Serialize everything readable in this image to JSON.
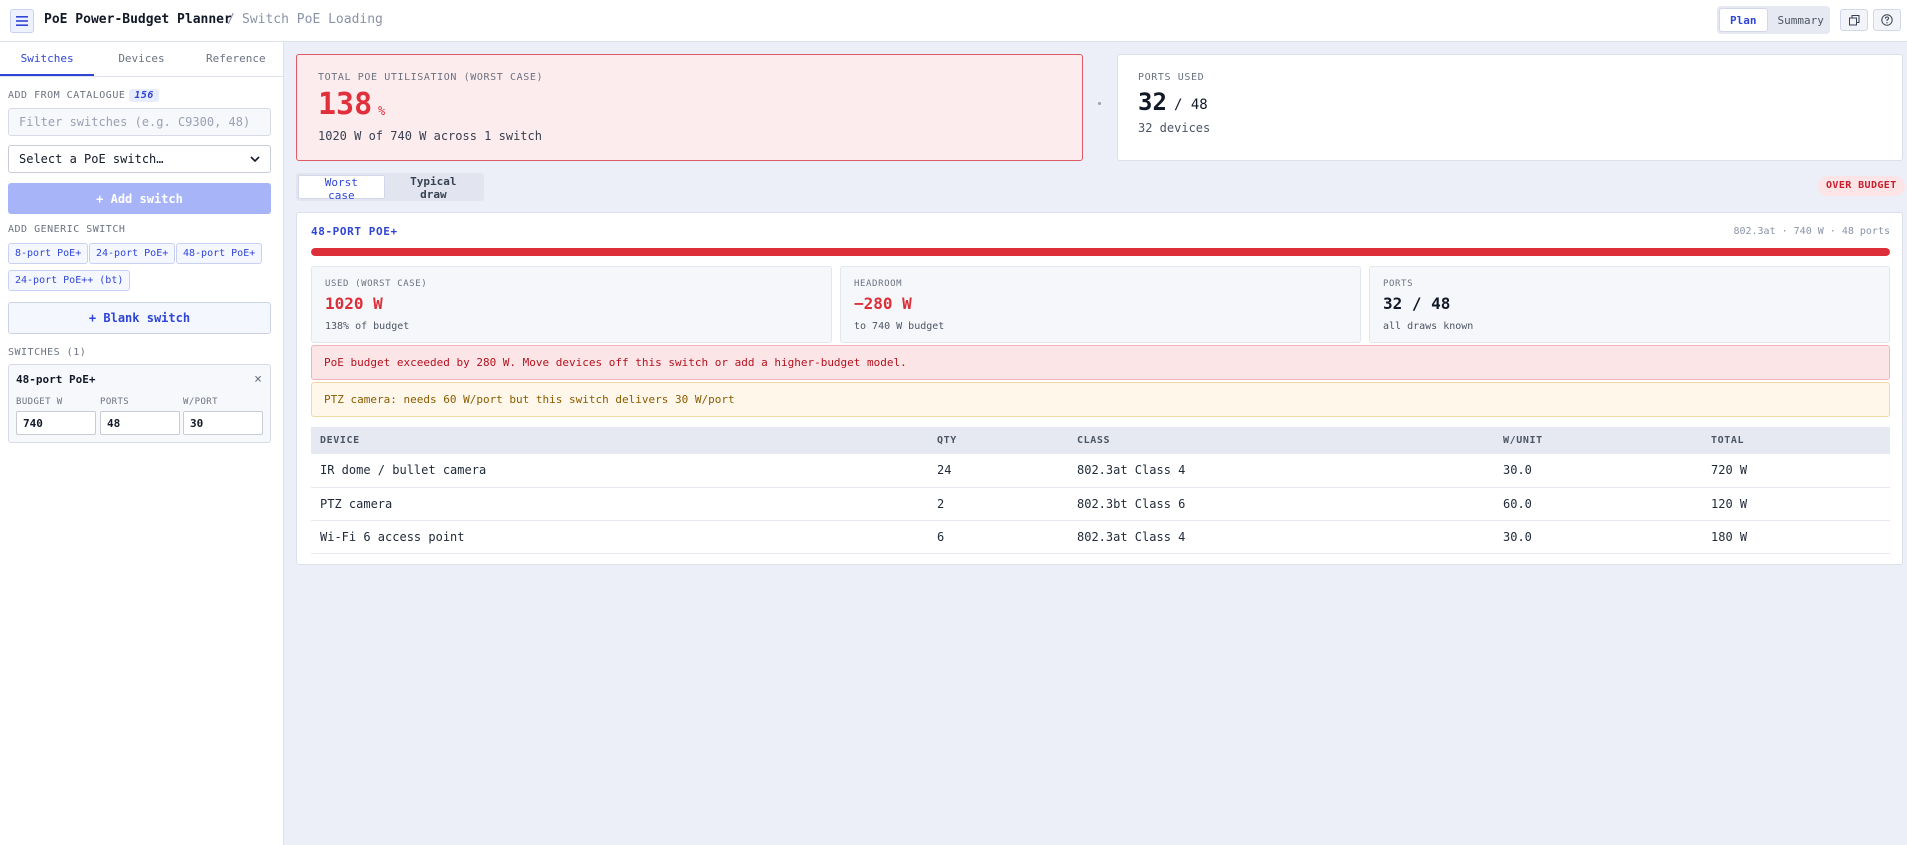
{
  "app": {
    "title": "PoE Power-Budget Planner",
    "separator": "/",
    "page": "Switch PoE Loading"
  },
  "topbar": {
    "modes": [
      "Plan",
      "Summary"
    ],
    "active_mode": "Plan",
    "icons": [
      "copy-icon",
      "help-icon"
    ]
  },
  "sidebar": {
    "tabs": [
      "Switches",
      "Devices",
      "Reference"
    ],
    "active_tab": "Switches",
    "catalogue_label": "ADD FROM CATALOGUE",
    "catalogue_count": "156",
    "filter_placeholder": "Filter switches (e.g. C9300, 48)",
    "select_value": "Select a PoE switch…",
    "add_switch_label": "+ Add switch",
    "generic_label": "ADD GENERIC SWITCH",
    "generic_chips": [
      "8-port PoE+",
      "24-port PoE+",
      "48-port PoE+",
      "24-port PoE++ (bt)"
    ],
    "blank_switch_label": "+ Blank switch",
    "switches_label": "SWITCHES (1)",
    "switch_card": {
      "name": "48-port PoE+",
      "close": "×",
      "fields": [
        {
          "label": "BUDGET W",
          "value": "740"
        },
        {
          "label": "PORTS",
          "value": "48"
        },
        {
          "label": "W/PORT",
          "value": "30"
        }
      ]
    }
  },
  "summary": {
    "util_caption": "TOTAL POE UTILISATION (WORST CASE)",
    "util_value": "138",
    "util_unit": "%",
    "util_detail": "1020 W of 740 W across 1 switch",
    "ports_caption": "PORTS USED",
    "ports_used": "32",
    "ports_total": "/ 48",
    "ports_detail": "32 devices"
  },
  "view": {
    "options": [
      "Worst case",
      "Typical draw"
    ],
    "active": "Worst case",
    "status_badge": "OVER BUDGET"
  },
  "switch_panel": {
    "title": "48-PORT POE+",
    "meta": "802.3at · 740 W · 48 ports",
    "utilisation_fraction": 1.0,
    "stats": [
      {
        "caption": "USED (WORST CASE)",
        "value": "1020 W",
        "sub": "138% of budget",
        "color": "#dc2f3a"
      },
      {
        "caption": "HEADROOM",
        "value": "−280 W",
        "sub": "to 740 W budget",
        "color": "#dc2f3a"
      },
      {
        "caption": "PORTS",
        "value": "32 / 48",
        "sub": "all draws known",
        "color": "#111827"
      }
    ],
    "error_alert": "PoE budget exceeded by 280 W. Move devices off this switch or add a higher-budget model.",
    "warning_alert": "PTZ camera: needs 60 W/port but this switch delivers 30 W/port",
    "table": {
      "headers": [
        "DEVICE",
        "QTY",
        "CLASS",
        "W/UNIT",
        "TOTAL"
      ],
      "rows": [
        [
          "IR dome / bullet camera",
          "24",
          "802.3at Class 4",
          "30.0",
          "720 W"
        ],
        [
          "PTZ camera",
          "2",
          "802.3bt Class 6",
          "60.0",
          "120 W"
        ],
        [
          "Wi-Fi 6 access point",
          "6",
          "802.3at Class 4",
          "30.0",
          "180 W"
        ]
      ]
    }
  },
  "colors": {
    "accent": "#2f45d6",
    "danger": "#dc2f3a",
    "warning_text": "#8a5a00"
  }
}
